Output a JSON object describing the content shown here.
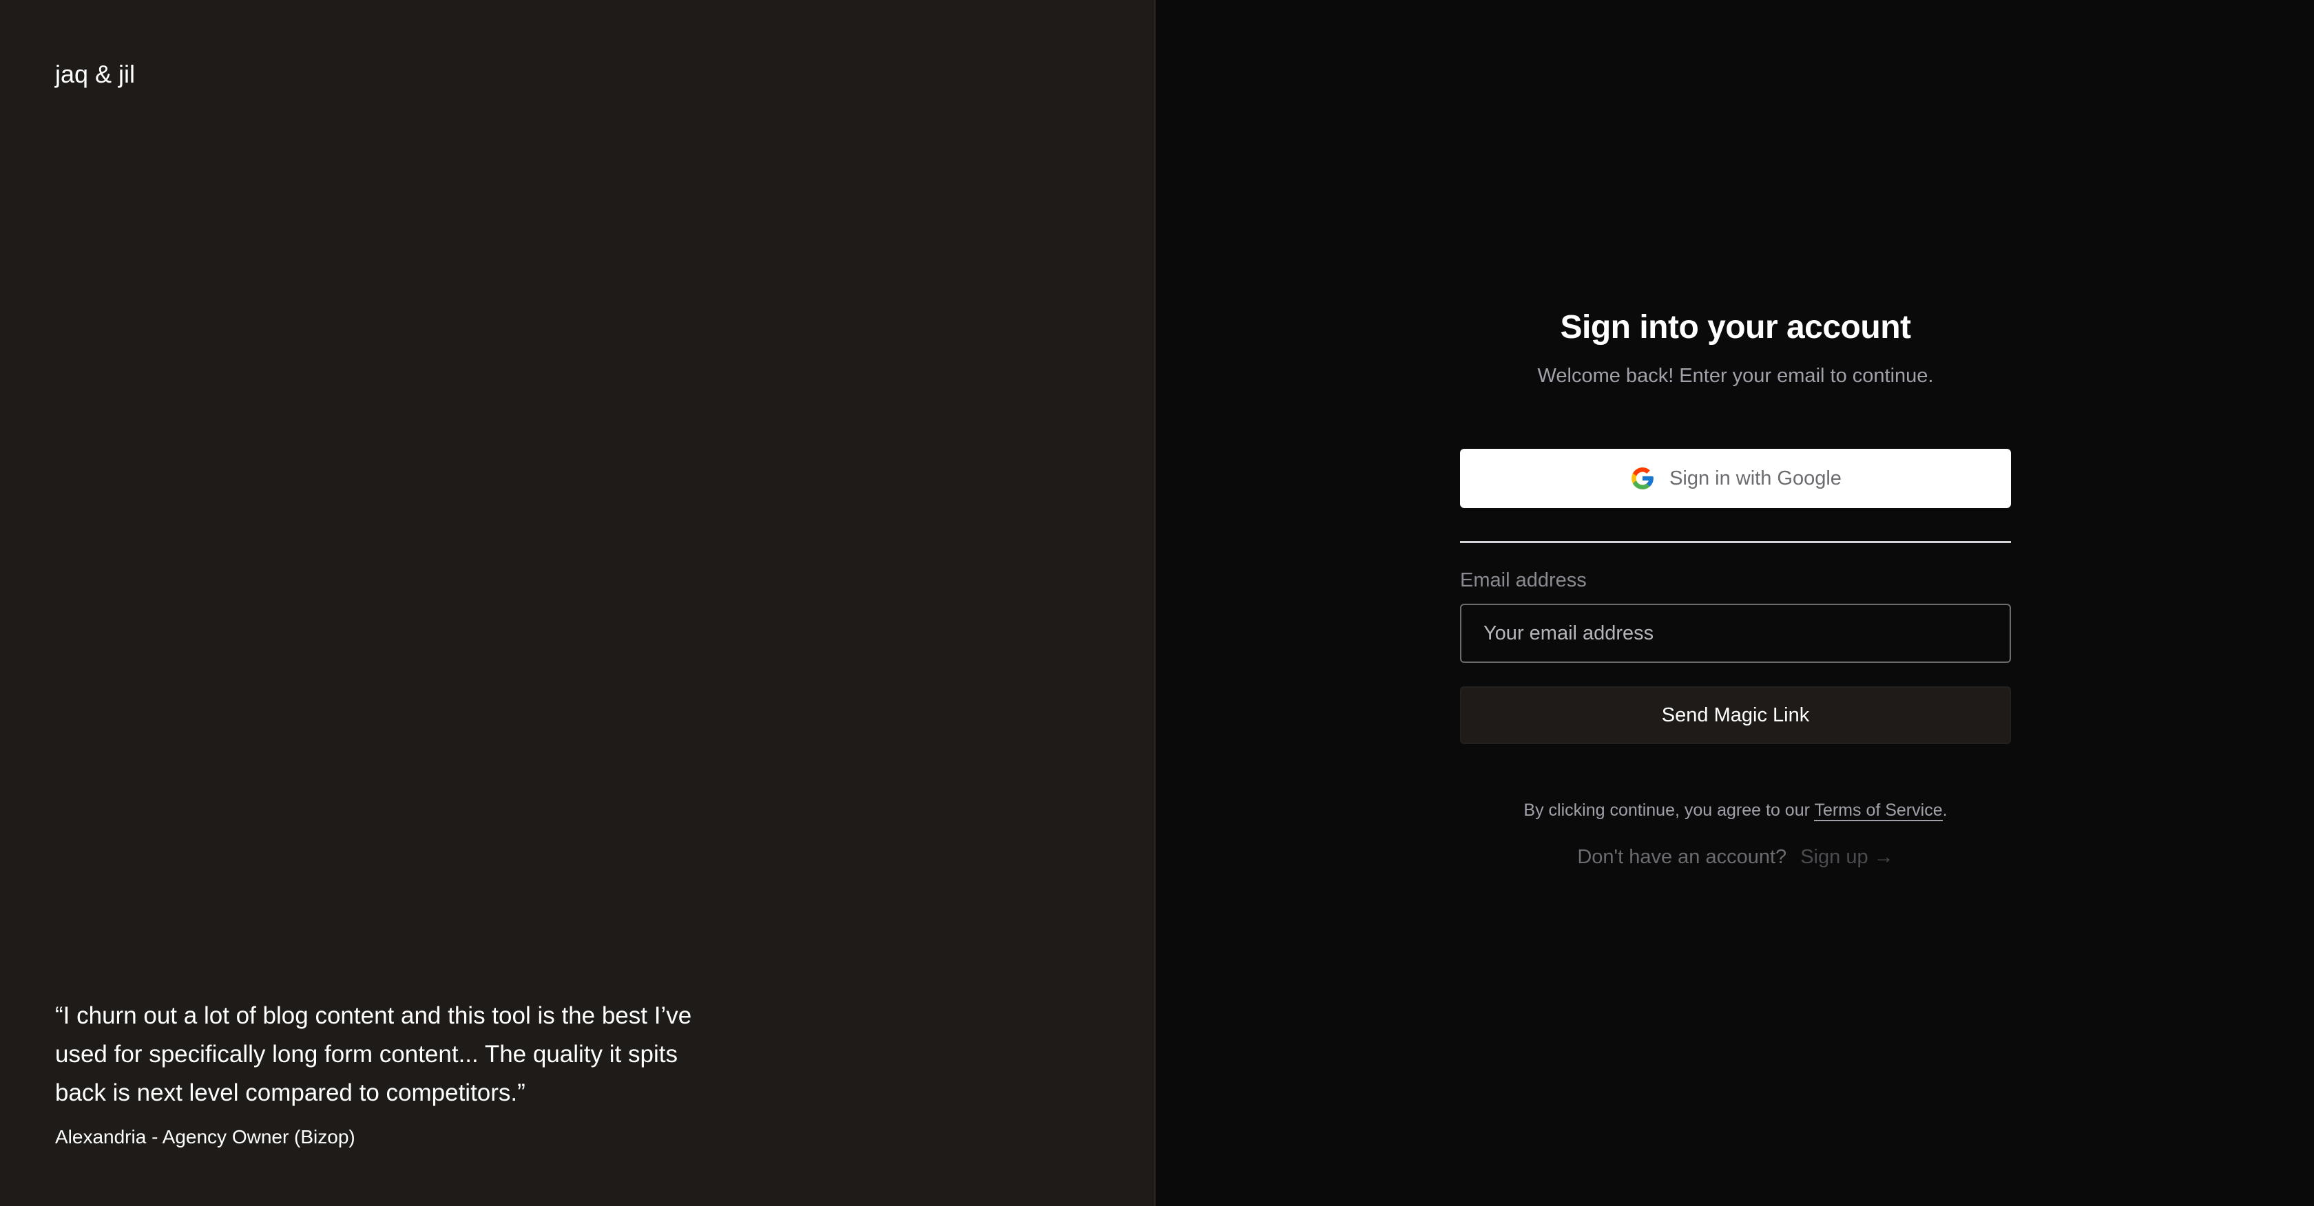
{
  "brand": {
    "name": "jaq & jil"
  },
  "testimonial": {
    "quote": "“I churn out a lot of blog content and this tool is the best I’ve used for specifically long form content... The quality it spits back is next level compared to competitors.”",
    "author": "Alexandria - Agency Owner (Bizop)"
  },
  "auth": {
    "title": "Sign into your account",
    "subtitle": "Welcome back! Enter your email to continue.",
    "google_button_label": "Sign in with Google",
    "google_icon": "google-g-icon",
    "email_label": "Email address",
    "email_placeholder": "Your email address",
    "email_value": "",
    "submit_label": "Send Magic Link",
    "terms_prefix": "By clicking continue, you agree to our ",
    "terms_link": "Terms of Service",
    "terms_suffix": ".",
    "signup_prompt": "Don't have an account?",
    "signup_link": "Sign up →"
  },
  "colors": {
    "left_panel_bg": "#1f1b18",
    "right_panel_bg": "#0a0a0b",
    "google_button_bg": "#ffffff"
  }
}
